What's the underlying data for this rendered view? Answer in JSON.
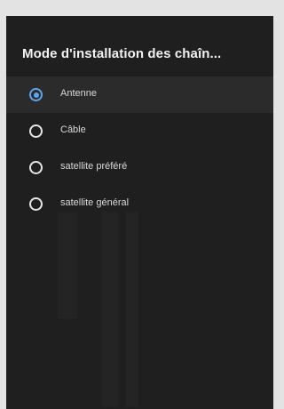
{
  "dialog": {
    "title": "Mode d'installation des chaîn...",
    "options": [
      {
        "label": "Antenne",
        "selected": true
      },
      {
        "label": "Câble",
        "selected": false
      },
      {
        "label": "satellite préféré",
        "selected": false
      },
      {
        "label": "satellite général",
        "selected": false
      }
    ],
    "accent_color": "#5fa5ee",
    "background_color": "#1f1f1f"
  }
}
